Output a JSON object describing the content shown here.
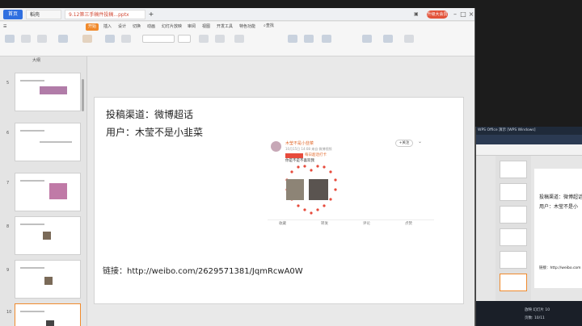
{
  "tabs": {
    "home": "首页",
    "daoke": "稻壳",
    "doc": "9.12第三手稿件投稿...pptx"
  },
  "titlebar": {
    "vip": "升级大会员"
  },
  "ribbon_tabs": [
    "开始",
    "插入",
    "设计",
    "切换",
    "动画",
    "幻灯片放映",
    "审阅",
    "视图",
    "开发工具",
    "特色功能"
  ],
  "ribbon_search": "查找",
  "pane": {
    "head": "大纲"
  },
  "thumbs": [
    "5",
    "6",
    "7",
    "8",
    "9",
    "10"
  ],
  "slide": {
    "line1": "投稿渠道：微博超话",
    "line2": "用户：木莹不是小韭菜",
    "link": "链接：http://weibo.com/2629571381/JqmRcwA0W"
  },
  "weibo": {
    "name": "木莹不是小韭菜",
    "time": "10月15日 14:08 来自 微博视频",
    "follow": "+关注",
    "topic": "每日超话打卡",
    "text": "你是不是不喜欢我",
    "actions": [
      "收藏",
      "转发",
      "评论",
      "点赞"
    ]
  },
  "second_window": {
    "title": "WPS Office 演示 [WPS Windows]",
    "t1": "投稿渠道：微博超话",
    "t2": "用户：木莹不是小",
    "link": "链接：http://weibo.com",
    "status1": "放映 幻灯片 10",
    "status2": "页数: 10/11"
  },
  "colors": {
    "accent": "#f08a2c",
    "tab_blue": "#2f6fe0",
    "weibo_red": "#e74b3c"
  }
}
